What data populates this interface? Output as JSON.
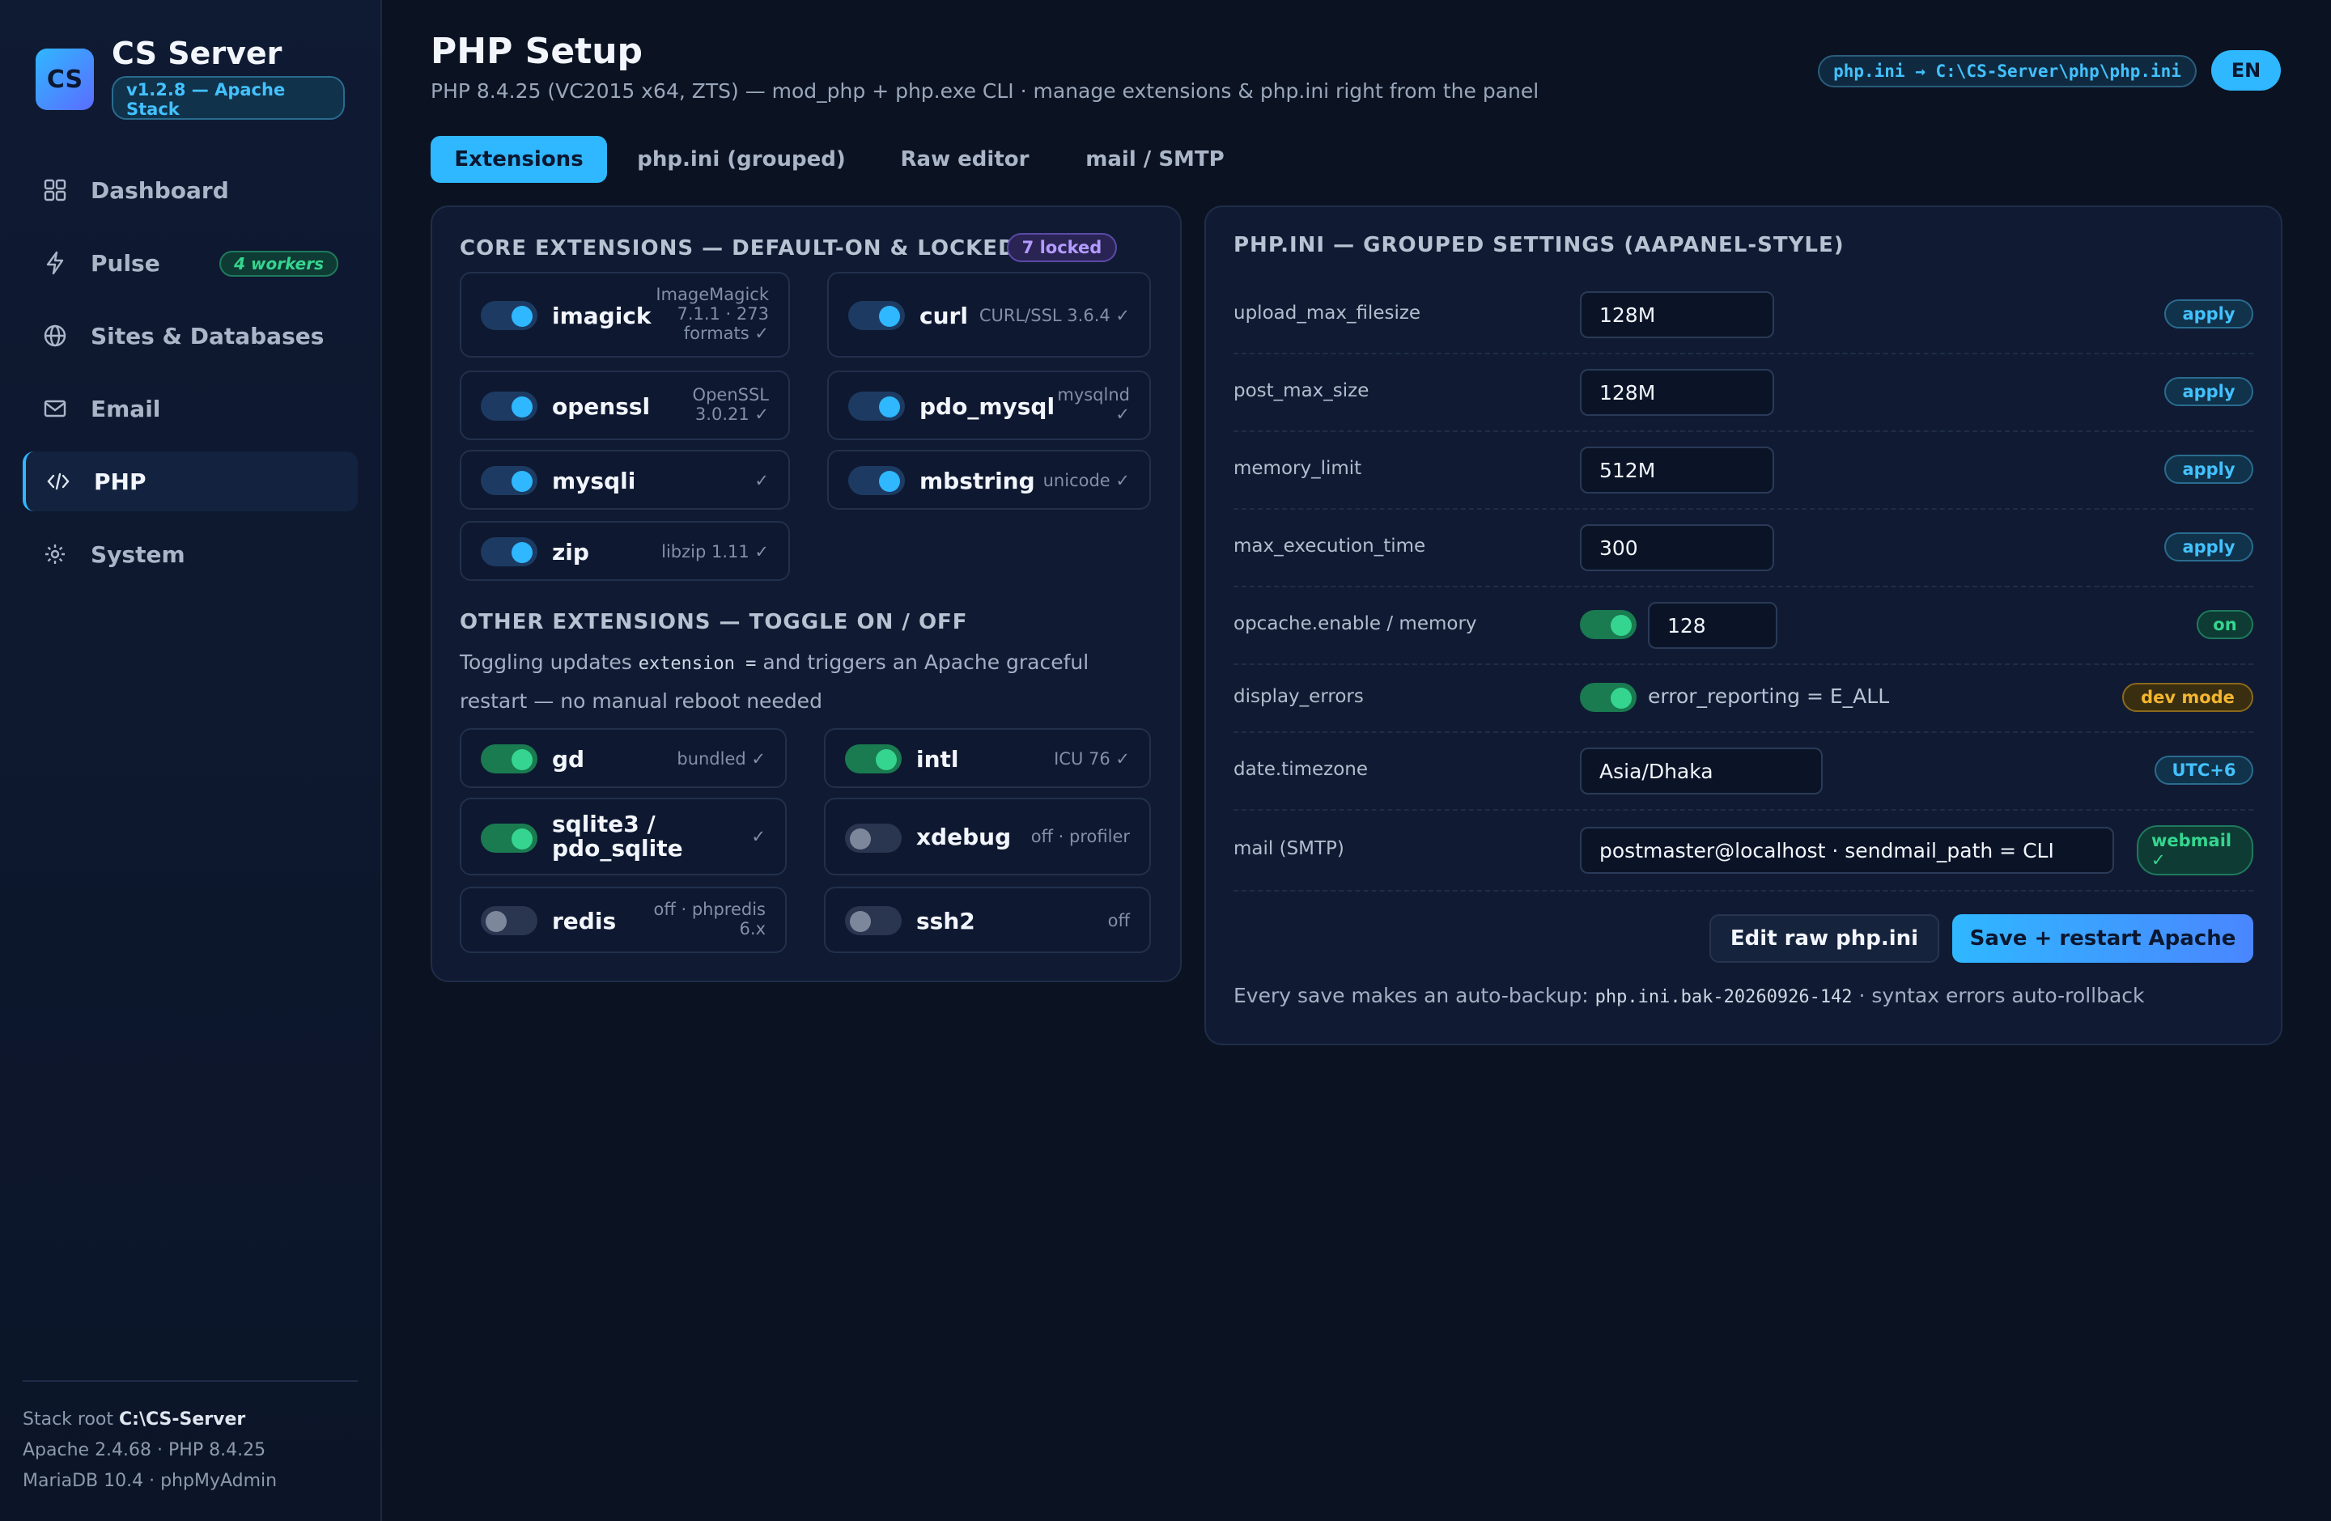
{
  "app": {
    "name": "CS Server",
    "version": "v1.2.8 — Apache Stack",
    "logo_text": "CS"
  },
  "sidebar": {
    "items": [
      {
        "label": "Dashboard",
        "icon": "grid-icon"
      },
      {
        "label": "Pulse",
        "icon": "bolt-icon",
        "badge": "4 workers"
      },
      {
        "label": "Sites & Databases",
        "icon": "globe-icon"
      },
      {
        "label": "Email",
        "icon": "mail-icon"
      },
      {
        "label": "PHP",
        "icon": "code-icon",
        "active": true
      },
      {
        "label": "System",
        "icon": "gear-icon"
      }
    ],
    "footer": {
      "root_label": "Stack root",
      "root_value": "C:\\CS-Server",
      "line2": "Apache 2.4.68 · PHP 8.4.25",
      "line3": "MariaDB 10.4 · phpMyAdmin"
    }
  },
  "header": {
    "title": "PHP Setup",
    "subtitle": "PHP 8.4.25 (VC2015 x64, ZTS) — mod_php + php.exe CLI · manage extensions & php.ini right from the panel",
    "ini_path": "php.ini → C:\\CS-Server\\php\\php.ini",
    "lang": "EN"
  },
  "tabs": [
    {
      "label": "Extensions",
      "active": true
    },
    {
      "label": "php.ini (grouped)"
    },
    {
      "label": "Raw editor"
    },
    {
      "label": "mail / SMTP"
    }
  ],
  "core": {
    "title": "CORE EXTENSIONS — DEFAULT-ON & LOCKED",
    "locked_badge": "7 locked",
    "extensions": [
      {
        "name": "imagick",
        "meta": "ImageMagick 7.1.1 · 273 formats ✓",
        "state": "on"
      },
      {
        "name": "curl",
        "meta": "CURL/SSL 3.6.4 ✓",
        "state": "on"
      },
      {
        "name": "openssl",
        "meta": "OpenSSL 3.0.21 ✓",
        "state": "on"
      },
      {
        "name": "pdo_mysql",
        "meta": "mysqlnd ✓",
        "state": "on"
      },
      {
        "name": "mysqli",
        "meta": "✓",
        "state": "on"
      },
      {
        "name": "mbstring",
        "meta": "unicode ✓",
        "state": "on"
      },
      {
        "name": "zip",
        "meta": "libzip 1.11 ✓",
        "state": "on"
      }
    ]
  },
  "other": {
    "title": "OTHER EXTENSIONS — TOGGLE ON / OFF",
    "desc_before": "Toggling updates",
    "desc_code": "extension =",
    "desc_after": "and triggers an Apache graceful restart — no manual reboot needed",
    "extensions": [
      {
        "name": "gd",
        "meta": "bundled ✓",
        "state": "on"
      },
      {
        "name": "intl",
        "meta": "ICU 76 ✓",
        "state": "on"
      },
      {
        "name": "sqlite3 / pdo_sqlite",
        "meta": "✓",
        "state": "on"
      },
      {
        "name": "xdebug",
        "meta": "off · profiler",
        "state": "off"
      },
      {
        "name": "redis",
        "meta": "off · phpredis 6.x",
        "state": "off"
      },
      {
        "name": "ssh2",
        "meta": "off",
        "state": "off"
      }
    ]
  },
  "ini": {
    "title": "PHP.INI — GROUPED SETTINGS (AAPANEL-STYLE)",
    "rows": [
      {
        "label": "upload_max_filesize",
        "value": "128M",
        "action": "apply"
      },
      {
        "label": "post_max_size",
        "value": "128M",
        "action": "apply"
      },
      {
        "label": "memory_limit",
        "value": "512M",
        "action": "apply"
      },
      {
        "label": "max_execution_time",
        "value": "300",
        "action": "apply"
      }
    ],
    "opcache": {
      "label": "opcache.enable / memory",
      "value": "128",
      "badge": "on"
    },
    "display_errors": {
      "label": "display_errors",
      "text": "error_reporting = E_ALL",
      "badge": "dev mode"
    },
    "timezone": {
      "label": "date.timezone",
      "value": "Asia/Dhaka",
      "badge": "UTC+6"
    },
    "mail": {
      "label": "mail (SMTP)",
      "value": "postmaster@localhost · sendmail_path = CLI",
      "badge": "webmail ✓"
    },
    "edit_raw_label": "Edit raw php.ini",
    "save_label": "Save + restart Apache",
    "note_before": "Every save makes an auto-backup:",
    "note_code": "php.ini.bak-20260926-142",
    "note_after": "· syntax errors auto-rollback"
  },
  "colors": {
    "accent": "#2fb7ff",
    "green": "#35d58f",
    "amber": "#f2b630",
    "violet": "#b39bff",
    "background": "#0b1322"
  }
}
